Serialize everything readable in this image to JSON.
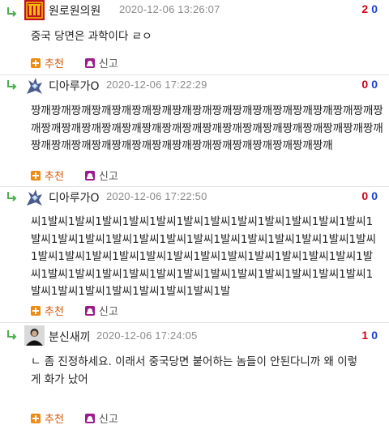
{
  "comments": [
    {
      "nickname": "원로원의원",
      "date": "2020-12-06 13:26:07",
      "up": "2",
      "down": "0",
      "text": "중국 당면은 과학이다 ㄹㅇ",
      "avatar_icon": "senate-emblem-icon"
    },
    {
      "nickname": "디아루가O",
      "date": "2020-12-06 17:22:29",
      "up": "0",
      "down": "0",
      "text": "짱깨짱깨짱깨짱깨짱깨짱깨짱깨짱깨짱깨짱깨짱깨짱깨짱깨짱깨짱깨짱깨짱깨짱깨짱깨짱깨짱깨짱깨짱깨짱깨짱깨짱깨짱깨짱깨짱깨짱깨짱깨짱깨짱깨짱깨짱깨짱깨짱깨짱깨짱깨짱깨짱깨짱깨짱깨짱깨짱깨짱깨짱깨짱깨짱깨짱깨",
      "avatar_icon": "dialga-icon"
    },
    {
      "nickname": "디아루가O",
      "date": "2020-12-06 17:22:50",
      "up": "0",
      "down": "0",
      "text": "씨1발씨1발씨1발씨1발씨1발씨1발씨1발씨1발씨1발씨1발씨1발씨1발씨1발씨1발씨1발씨1발씨1발씨1발씨1발씨1발씨1발씨1발씨1발씨1발씨1발씨1발씨1발씨1발씨1발씨1발씨1발씨1발씨1발씨1발씨1발씨1발씨1발씨1발씨1발씨1발씨1발씨1발씨1발씨1발씨1발씨1발씨1발씨1발씨1발씨1발씨1발씨1발씨1발씨1발씨1발씨1발씨1발씨1발",
      "avatar_icon": "dialga-icon"
    },
    {
      "nickname": "분신새끼",
      "date": "2020-12-06 17:24:05",
      "up": "1",
      "down": "0",
      "text": "ㄴ 좀 진정하세요. 이래서 중국당면 붙어하는 놈들이 안된다니까 왜 이렇게 화가 났어",
      "avatar_icon": "person-photo-icon"
    }
  ],
  "actions": {
    "recommend_label": "추천",
    "report_label": "신고"
  },
  "colors": {
    "upvote": "#d0021b",
    "downvote": "#1a3fd6",
    "recommend": "#ef8a13",
    "report": "#9c1c8c"
  }
}
